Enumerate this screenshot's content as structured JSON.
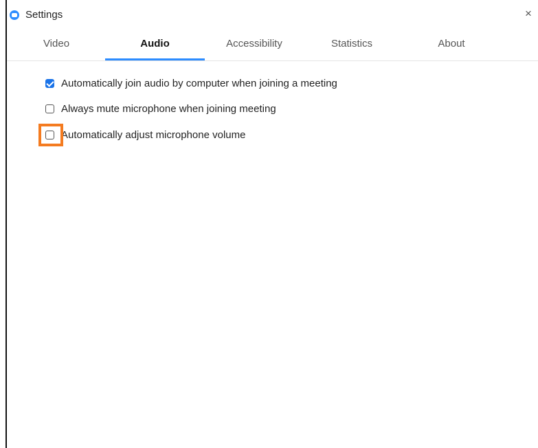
{
  "window": {
    "title": "Settings",
    "close_glyph": "×",
    "app_icon": "zoom-camera-icon",
    "accent_color": "#2d8cff",
    "highlight_color": "#f47b20"
  },
  "tabs": [
    {
      "label": "Video",
      "active": false
    },
    {
      "label": "Audio",
      "active": true
    },
    {
      "label": "Accessibility",
      "active": false
    },
    {
      "label": "Statistics",
      "active": false
    },
    {
      "label": "About",
      "active": false
    }
  ],
  "options": [
    {
      "label": "Automatically join audio by computer when joining a meeting",
      "checked": true
    },
    {
      "label": "Always mute microphone when joining meeting",
      "checked": false
    },
    {
      "label": "Automatically adjust microphone volume",
      "checked": false
    }
  ]
}
